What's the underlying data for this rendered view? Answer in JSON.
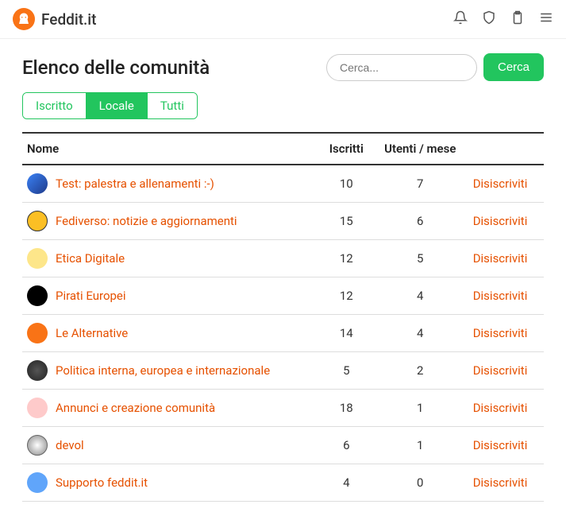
{
  "brand": {
    "name": "Feddit.it"
  },
  "page": {
    "title": "Elenco delle comunità"
  },
  "search": {
    "placeholder": "Cerca...",
    "button": "Cerca"
  },
  "tabs": [
    {
      "label": "Iscritto",
      "active": false
    },
    {
      "label": "Locale",
      "active": true
    },
    {
      "label": "Tutti",
      "active": false
    }
  ],
  "table": {
    "headers": {
      "name": "Nome",
      "subs": "Iscritti",
      "users": "Utenti / mese",
      "action": ""
    },
    "action_label": "Disiscriviti",
    "rows": [
      {
        "name": "Test: palestra e allenamenti :-)",
        "subs": 10,
        "users": 7,
        "icon_class": "ic0"
      },
      {
        "name": "Fediverso: notizie e aggiornamenti",
        "subs": 15,
        "users": 6,
        "icon_class": "ic1"
      },
      {
        "name": "Etica Digitale",
        "subs": 12,
        "users": 5,
        "icon_class": "ic2"
      },
      {
        "name": "Pirati Europei",
        "subs": 12,
        "users": 4,
        "icon_class": "ic3"
      },
      {
        "name": "Le Alternative",
        "subs": 14,
        "users": 4,
        "icon_class": "ic4"
      },
      {
        "name": "Politica interna, europea e internazionale",
        "subs": 5,
        "users": 2,
        "icon_class": "ic5"
      },
      {
        "name": "Annunci e creazione comunità",
        "subs": 18,
        "users": 1,
        "icon_class": "ic6"
      },
      {
        "name": "devol",
        "subs": 6,
        "users": 1,
        "icon_class": "ic7"
      },
      {
        "name": "Supporto feddit.it",
        "subs": 4,
        "users": 0,
        "icon_class": "ic8"
      }
    ]
  }
}
